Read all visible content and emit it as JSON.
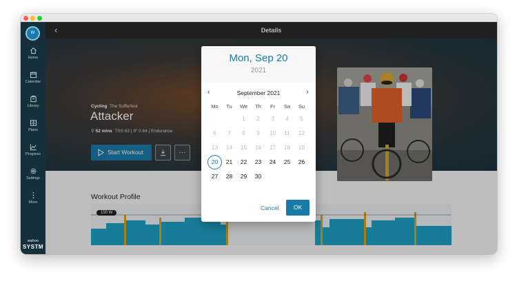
{
  "header": {
    "title": "Details"
  },
  "user": {
    "initial": "W"
  },
  "sidebar": {
    "items": [
      {
        "label": "Home",
        "icon": "home-icon"
      },
      {
        "label": "Calendar",
        "icon": "calendar-icon"
      },
      {
        "label": "Library",
        "icon": "library-icon"
      },
      {
        "label": "Plans",
        "icon": "plans-icon"
      },
      {
        "label": "Progress",
        "icon": "progress-icon"
      },
      {
        "label": "Settings",
        "icon": "gear-icon"
      },
      {
        "label": "More",
        "icon": "more-icon"
      }
    ],
    "brand_small": "wahoo",
    "brand_big": "SYSTM"
  },
  "workout": {
    "category": "Cycling",
    "source": "The Sufferfest",
    "title": "Attacker",
    "duration": "52 mins",
    "tss": "TSS 62",
    "if": "IF 0.84",
    "type": "Endurance",
    "start_label": "Start Workout",
    "more_label": "···"
  },
  "profile": {
    "title": "Workout Profile",
    "ftp_tag": "150 W"
  },
  "datepicker": {
    "selected_label": "Mon, Sep 20",
    "year": "2021",
    "month_label": "September 2021",
    "weekdays": [
      "Mo",
      "Tu",
      "We",
      "Th",
      "Fr",
      "Sa",
      "Su"
    ],
    "selected_day": 20,
    "first_enabled_day": 20,
    "days": [
      [
        null,
        null,
        "1",
        "2",
        "3",
        "4",
        "5"
      ],
      [
        "6",
        "7",
        "8",
        "9",
        "10",
        "11",
        "12"
      ],
      [
        "13",
        "14",
        "15",
        "16",
        "17",
        "18",
        "19"
      ],
      [
        "20",
        "21",
        "22",
        "23",
        "24",
        "25",
        "26"
      ],
      [
        "27",
        "28",
        "29",
        "30",
        null,
        null,
        null
      ]
    ],
    "cancel_label": "Cancel",
    "ok_label": "OK"
  },
  "colors": {
    "accent": "#1a7aa8",
    "sidebar": "#16303b",
    "chart_bar": "#1e9fc3",
    "chart_highlight": "#d6a21e"
  }
}
